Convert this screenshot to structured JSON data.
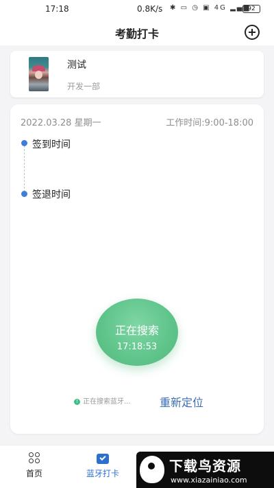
{
  "status_bar": {
    "time": "17:18",
    "network_speed": "0.8K/s",
    "signal_label": "4G",
    "battery": "92"
  },
  "header": {
    "title": "考勤打卡"
  },
  "profile": {
    "name": "测试",
    "department": "开发一部"
  },
  "attendance": {
    "date": "2022.03.28",
    "weekday": "星期一",
    "work_hours": "工作时间:9:00-18:00",
    "check_in_label": "签到时间",
    "check_out_label": "签退时间"
  },
  "checkin_button": {
    "label": "正在搜索",
    "time": "17:18:53"
  },
  "search": {
    "status_text": "正在搜索蓝牙...",
    "relocate_label": "重新定位"
  },
  "bottom_nav": {
    "items": [
      {
        "label": "首页"
      },
      {
        "label": "蓝牙打卡"
      }
    ]
  },
  "watermark": {
    "title": "下载鸟资源",
    "url": "www.xiazainiao.com"
  },
  "colors": {
    "accent_blue": "#2c6fcf",
    "button_green": "#5ec48a",
    "relocate_blue": "#3a6db5"
  }
}
